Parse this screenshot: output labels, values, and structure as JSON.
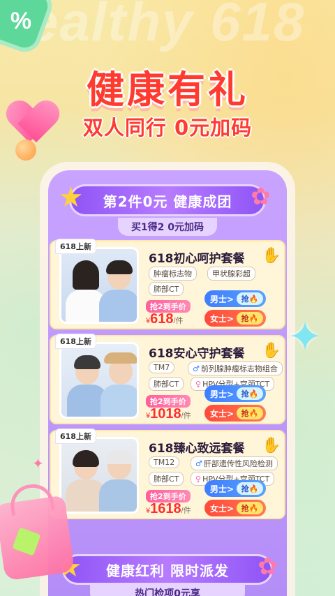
{
  "bg_text": "ealthy 618",
  "corner_badge": "%",
  "hero": {
    "title": "健康有礼",
    "subtitle": "双人同行 0元加码"
  },
  "section1": {
    "ribbon": "第2件0元 健康成团",
    "sub": "买1得2 0元加码"
  },
  "cards": [
    {
      "tag": "618上新",
      "name": "618初心呵护套餐",
      "chips": [
        "肿瘤标志物",
        "甲状腺彩超",
        "肺部CT"
      ],
      "price_label": "抢2到手价",
      "currency": "¥",
      "price": "618",
      "unit": "/件",
      "male_label": "男士>",
      "female_label": "女士>",
      "grab_label": "抢"
    },
    {
      "tag": "618上新",
      "name": "618安心守护套餐",
      "chips": [
        "TM7",
        "前列腺肿瘤标志物组合",
        "肺部CT",
        "HPV分型+宫颈TCT"
      ],
      "price_label": "抢2到手价",
      "currency": "¥",
      "price": "1018",
      "unit": "/件",
      "male_label": "男士>",
      "female_label": "女士>",
      "grab_label": "抢"
    },
    {
      "tag": "618上新",
      "name": "618臻心致远套餐",
      "chips": [
        "TM12",
        "肝部遗传性风险检测",
        "肺部CT",
        "HPV分型+宫颈TCT"
      ],
      "price_label": "抢2到手价",
      "currency": "¥",
      "price": "1618",
      "unit": "/件",
      "male_label": "男士>",
      "female_label": "女士>",
      "grab_label": "抢"
    }
  ],
  "section2": {
    "ribbon": "健康红利 限时派发",
    "sub": "热门检项0元享"
  },
  "icons": {
    "male": "♂",
    "female": "♀",
    "fire": "🔥"
  },
  "colors": {
    "accent_red": "#ff3a2f",
    "purple": "#b48ef7",
    "male_blue": "#3e7dff",
    "female_red": "#ff4a3a"
  }
}
